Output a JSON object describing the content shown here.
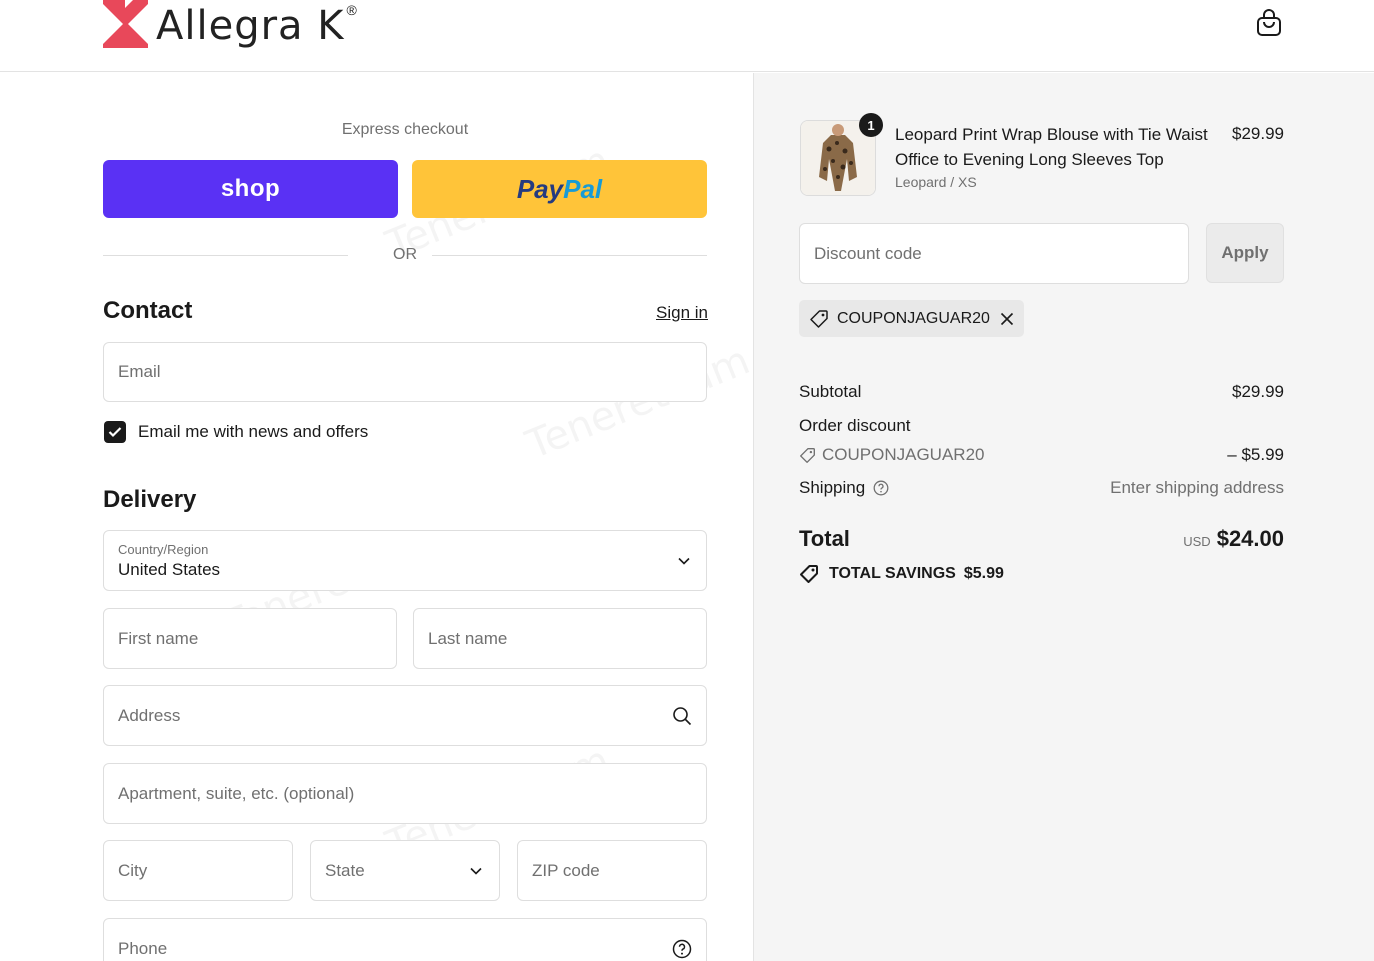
{
  "header": {
    "logo_text": "Allegra K",
    "logo_reg": "®",
    "cart_icon": "shopping-bag-icon"
  },
  "express": {
    "label": "Express checkout",
    "shop_label": "shop",
    "paypal_pay": "Pay",
    "paypal_pal": "Pal",
    "or_label": "OR"
  },
  "contact": {
    "title": "Contact",
    "sign_in": "Sign in",
    "email_placeholder": "Email",
    "newsletter_label": "Email me with news and offers",
    "newsletter_checked": true
  },
  "delivery": {
    "title": "Delivery",
    "country_label": "Country/Region",
    "country_value": "United States",
    "first_name_placeholder": "First name",
    "last_name_placeholder": "Last name",
    "address_placeholder": "Address",
    "apartment_placeholder": "Apartment, suite, etc. (optional)",
    "city_placeholder": "City",
    "state_placeholder": "State",
    "zip_placeholder": "ZIP code",
    "phone_placeholder": "Phone"
  },
  "order": {
    "item": {
      "quantity": "1",
      "title": "Leopard Print Wrap Blouse with Tie Waist Office to Evening Long Sleeves Top",
      "variant": "Leopard / XS",
      "price": "$29.99"
    },
    "discount_placeholder": "Discount code",
    "apply_label": "Apply",
    "applied_coupon": "COUPONJAGUAR20",
    "subtotal_label": "Subtotal",
    "subtotal_value": "$29.99",
    "order_discount_label": "Order discount",
    "discount_code": "COUPONJAGUAR20",
    "discount_value": "– $5.99",
    "shipping_label": "Shipping",
    "shipping_value": "Enter shipping address",
    "total_label": "Total",
    "total_currency": "USD",
    "total_value": "$24.00",
    "savings_label": "TOTAL SAVINGS",
    "savings_value": "$5.99"
  },
  "colors": {
    "shop_purple": "#5a31f4",
    "paypal_yellow": "#ffc439",
    "panel_bg": "#f5f5f5"
  }
}
